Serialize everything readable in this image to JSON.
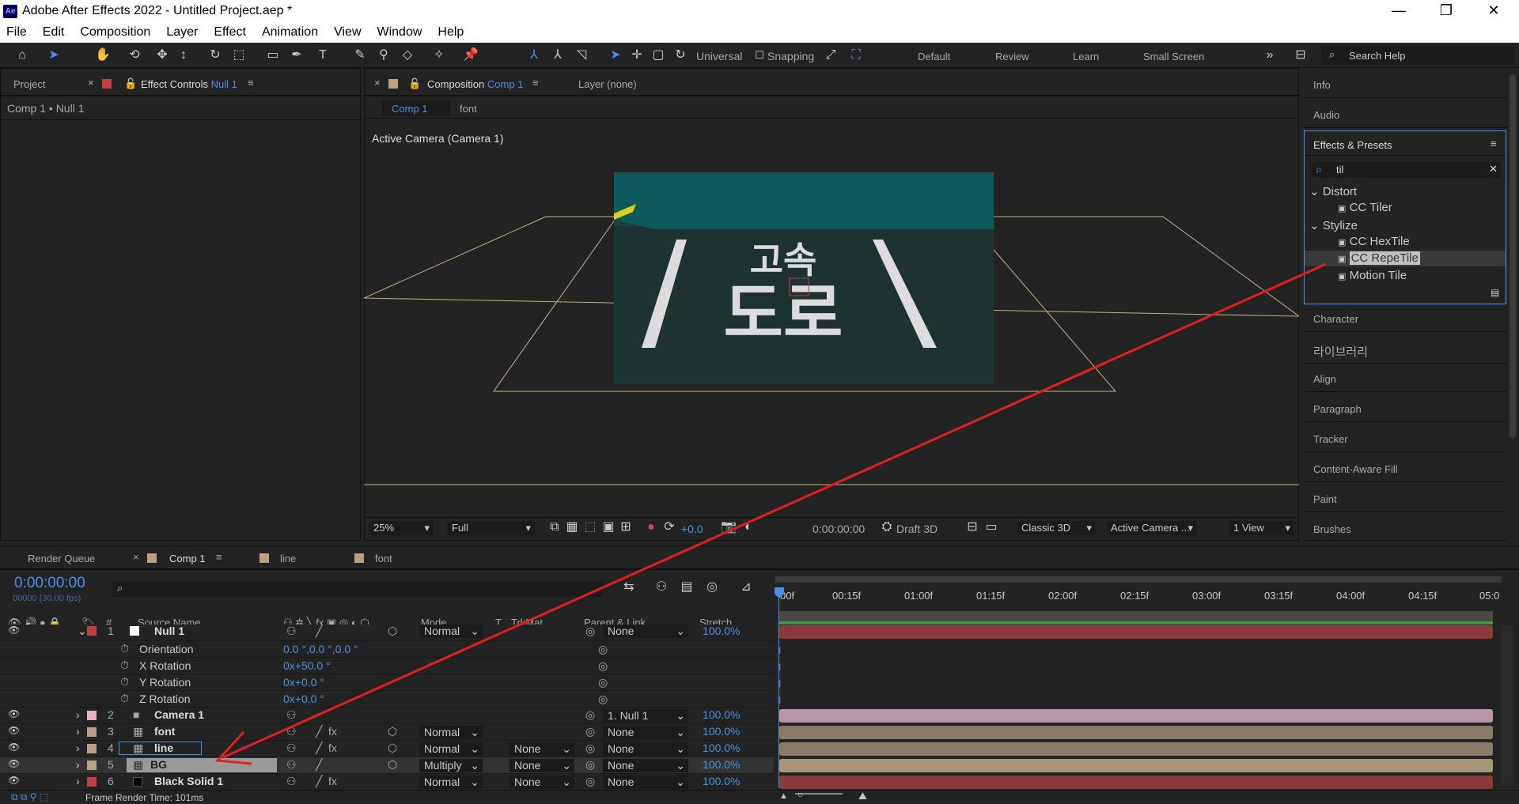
{
  "window": {
    "title": "Adobe After Effects 2022 - Untitled Project.aep *",
    "logo": "Ae"
  },
  "menu": [
    "File",
    "Edit",
    "Composition",
    "Layer",
    "Effect",
    "Animation",
    "View",
    "Window",
    "Help"
  ],
  "toolbar": {
    "axis_mode": "Universal",
    "snapping": "Snapping",
    "workspaces": [
      "Default",
      "Review",
      "Learn",
      "Small Screen"
    ],
    "search_placeholder": "Search Help"
  },
  "left_panel": {
    "tab_project": "Project",
    "tab_effect_controls": "Effect Controls",
    "effect_target": "Null 1",
    "breadcrumb": "Comp 1 • Null 1"
  },
  "comp_panel": {
    "tab_label": "Composition",
    "comp_name": "Comp 1",
    "layer_tab": "Layer (none)",
    "subtabs": [
      "Comp 1",
      "font"
    ],
    "viewer_label": "Active Camera (Camera 1)",
    "footer": {
      "zoom": "25%",
      "resolution": "Full",
      "exposure": "+0.0",
      "timecode": "0:00:00:00",
      "draft3d": "Draft 3D",
      "renderer": "Classic 3D",
      "view": "Active Camera ...",
      "views": "1 View"
    }
  },
  "right_panels": {
    "info": "Info",
    "audio": "Audio",
    "effects_presets": "Effects & Presets",
    "search_value": "til",
    "tree": [
      {
        "label": "Distort",
        "children": [
          "CC Tiler"
        ]
      },
      {
        "label": "Stylize",
        "children": [
          "CC HexTile",
          "CC RepeTile",
          "Motion Tile"
        ]
      }
    ],
    "selected": "CC RepeTile",
    "lower": [
      "Character",
      "라이브러리",
      "Align",
      "Paragraph",
      "Tracker",
      "Content-Aware Fill",
      "Paint",
      "Brushes"
    ]
  },
  "timeline": {
    "tabs": [
      "Render Queue",
      "Comp 1",
      "line",
      "font"
    ],
    "timecode": "0:00:00:00",
    "fps": "00000 (30.00 fps)",
    "headers": {
      "num": "#",
      "source": "Source Name",
      "mode": "Mode",
      "t": "T",
      "trkmat": "TrkMat",
      "parent": "Parent & Link",
      "stretch": "Stretch"
    },
    "ruler": [
      "00f",
      "00:15f",
      "01:00f",
      "01:15f",
      "02:00f",
      "02:15f",
      "03:00f",
      "03:15f",
      "04:00f",
      "04:15f",
      "05:0"
    ],
    "layers": [
      {
        "num": "1",
        "name": "Null 1",
        "mode": "Normal",
        "trkmat": "",
        "parent": "None",
        "stretch": "100.0%",
        "color": "#c04040"
      },
      {
        "num": "2",
        "name": "Camera 1",
        "mode": "",
        "trkmat": "",
        "parent": "1. Null 1",
        "stretch": "100.0%",
        "color": "#e8b0c0"
      },
      {
        "num": "3",
        "name": "font",
        "mode": "Normal",
        "trkmat": "",
        "parent": "None",
        "stretch": "100.0%",
        "color": "#b8a080"
      },
      {
        "num": "4",
        "name": "line",
        "mode": "Normal",
        "trkmat": "None",
        "parent": "None",
        "stretch": "100.0%",
        "color": "#b8a080"
      },
      {
        "num": "5",
        "name": "BG",
        "mode": "Multiply",
        "trkmat": "None",
        "parent": "None",
        "stretch": "100.0%",
        "color": "#b8a080"
      },
      {
        "num": "6",
        "name": "Black Solid 1",
        "mode": "Normal",
        "trkmat": "None",
        "parent": "None",
        "stretch": "100.0%",
        "color": "#c04040"
      }
    ],
    "props": [
      {
        "name": "Orientation",
        "value": "0.0 °,0.0 °,0.0 °"
      },
      {
        "name": "X Rotation",
        "value": "0x+50.0 °"
      },
      {
        "name": "Y Rotation",
        "value": "0x+0.0 °"
      },
      {
        "name": "Z Rotation",
        "value": "0x+0.0 °"
      }
    ],
    "status": "Frame Render Time: 101ms"
  },
  "canvas_text": {
    "line1": "고속",
    "line2": "도로"
  },
  "colors": {
    "accent": "#4a90e2",
    "arrow": "#e02020",
    "teal": "#0d5a5a",
    "road": "#1e3232"
  }
}
